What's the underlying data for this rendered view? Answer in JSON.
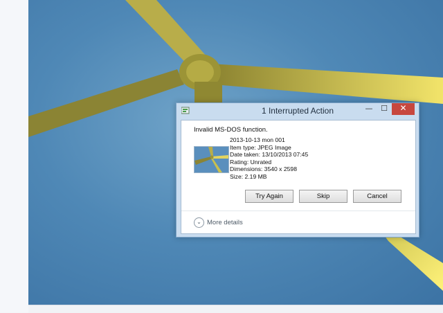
{
  "dialog": {
    "title": "1 Interrupted Action",
    "minimize_icon": "minimize-icon",
    "maximize_icon": "maximize-icon",
    "close_icon": "close-icon",
    "message": "Invalid MS-DOS function.",
    "file": {
      "name": "2013-10-13 mon 001",
      "item_type": "Item type: JPEG Image",
      "date_taken": "Date taken: 13/10/2013 07:45",
      "rating": "Rating: Unrated",
      "dimensions": "Dimensions: 3540 x 2598",
      "size": "Size: 2.19 MB"
    },
    "buttons": {
      "try_again": "Try Again",
      "skip": "Skip",
      "cancel": "Cancel"
    },
    "more_details": "More details"
  },
  "colors": {
    "close_button": "#c7473e",
    "dialog_frame": "#c9dcef",
    "sky": "#4f88b6",
    "turbine_blade": "#d4c15a"
  }
}
